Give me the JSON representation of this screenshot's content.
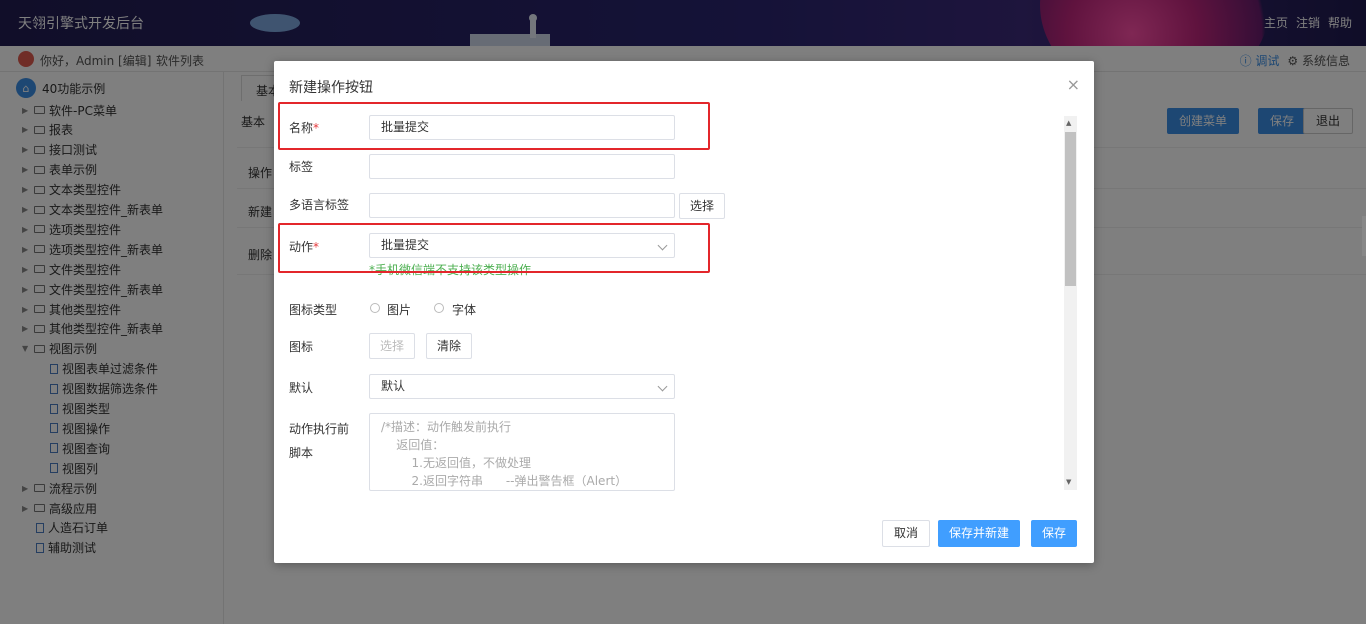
{
  "header": {
    "app_title": "天翎引擎式开发后台",
    "links": [
      "主页",
      "注销",
      "帮助"
    ]
  },
  "subbar": {
    "greeting": "你好，Admin [编辑]",
    "software_list": "软件列表",
    "debug": "ⓘ 调试",
    "system_info": "⚙ 系统信息"
  },
  "sidebar": {
    "root": "40功能示例",
    "items": [
      {
        "label": "软件-PC菜单",
        "type": "folder"
      },
      {
        "label": "报表",
        "type": "folder"
      },
      {
        "label": "接口测试",
        "type": "folder"
      },
      {
        "label": "表单示例",
        "type": "folder"
      },
      {
        "label": "文本类型控件",
        "type": "folder"
      },
      {
        "label": "文本类型控件_新表单",
        "type": "folder"
      },
      {
        "label": "选项类型控件",
        "type": "folder"
      },
      {
        "label": "选项类型控件_新表单",
        "type": "folder"
      },
      {
        "label": "文件类型控件",
        "type": "folder"
      },
      {
        "label": "文件类型控件_新表单",
        "type": "folder"
      },
      {
        "label": "其他类型控件",
        "type": "folder"
      },
      {
        "label": "其他类型控件_新表单",
        "type": "folder"
      },
      {
        "label": "视图示例",
        "type": "folder-open"
      },
      {
        "label": "视图表单过滤条件",
        "type": "doc"
      },
      {
        "label": "视图数据筛选条件",
        "type": "doc"
      },
      {
        "label": "视图类型",
        "type": "doc"
      },
      {
        "label": "视图操作",
        "type": "doc"
      },
      {
        "label": "视图查询",
        "type": "doc"
      },
      {
        "label": "视图列",
        "type": "doc"
      },
      {
        "label": "流程示例",
        "type": "folder"
      },
      {
        "label": "高级应用",
        "type": "folder"
      },
      {
        "label": "人造石订单",
        "type": "doc"
      },
      {
        "label": "辅助测试",
        "type": "doc"
      }
    ]
  },
  "main": {
    "tab": "基本",
    "section": "基本",
    "create_menu": "创建菜单",
    "save": "保存",
    "exit": "退出",
    "rows": [
      "操作",
      "新建",
      "删除"
    ]
  },
  "modal": {
    "title": "新建操作按钮",
    "close": "×",
    "name_label": "名称",
    "name_value": "批量提交",
    "tag_label": "标签",
    "tag_value": "",
    "i18n_label": "多语言标签",
    "i18n_value": "",
    "choose": "选择",
    "action_label": "动作",
    "action_value": "批量提交",
    "action_hint": "*手机微信端不支持该类型操作",
    "icon_type_label": "图标类型",
    "icon_type_options": [
      "图片",
      "字体"
    ],
    "icon_label": "图标",
    "icon_choose": "选择",
    "icon_clear": "清除",
    "default_label": "默认",
    "default_value": "默认",
    "script_label": "动作执行前\n脚本",
    "script_text": "/*描述：动作触发前执行\n    返回值：\n        1.无返回值，不做处理\n        2.返回字符串      --弹出警告框（Alert）",
    "required_mark": "*",
    "buttons": {
      "cancel": "取消",
      "save_new": "保存并新建",
      "save": "保存"
    }
  }
}
